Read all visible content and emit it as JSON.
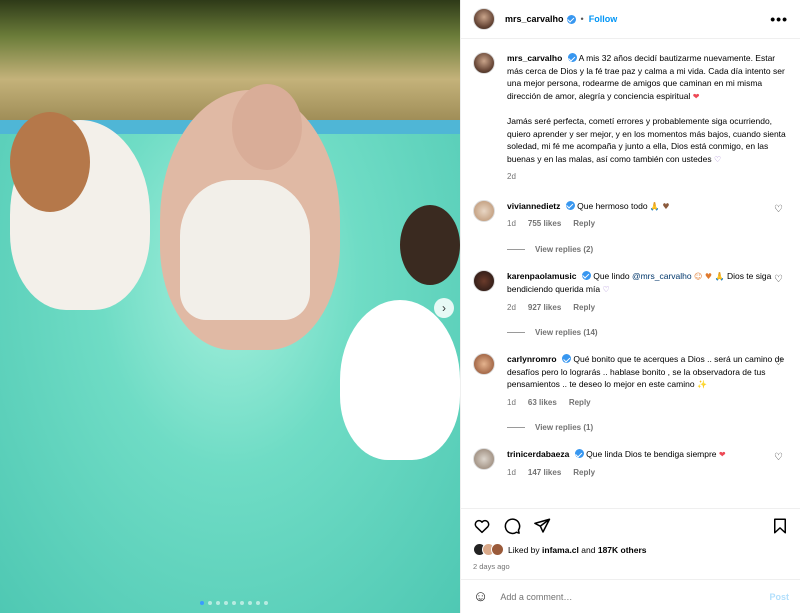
{
  "post": {
    "username": "mrs_carvalho",
    "follow_label": "Follow",
    "more_label": "•••"
  },
  "caption": {
    "username": "mrs_carvalho",
    "paragraph1": "A mis 32 años decidí bautizarme nuevamente. Estar más cerca de Dios y la fé trae paz y calma a mi vida. Cada día intento ser una mejor persona, rodearme de amigos que caminan en mi misma dirección de amor, alegría y conciencia espiritual",
    "paragraph1_emoji": "❤",
    "paragraph2": "Jamás seré perfecta, cometí errores y probablemente siga ocurriendo, quiero aprender y ser mejor, y en los momentos más bajos, cuando sienta soledad, mi fé me acompaña y junto a ella, Dios está conmigo, en las buenas y en las malas, así como también con ustedes",
    "paragraph2_emoji": "♡",
    "time": "2d"
  },
  "comments": [
    {
      "username": "viviannedietz",
      "text": "Que hermoso todo",
      "emoji": "🙏 ♥",
      "time": "1d",
      "likes": "755 likes",
      "reply_label": "Reply",
      "view_replies": "View replies (2)"
    },
    {
      "username": "karenpaolamusic",
      "text_before": "Que lindo",
      "mention": "@mrs_carvalho",
      "emoji": "☺ ♥ 🙏",
      "text_after": "Dios te siga bendiciendo querida mía",
      "emoji_after": "♡",
      "time": "2d",
      "likes": "927 likes",
      "reply_label": "Reply",
      "view_replies": "View replies (14)"
    },
    {
      "username": "carlynromro",
      "text": "Qué bonito que te acerques a Dios .. será un camino de desafíos pero lo lograrás .. hablase bonito , se la observadora de tus pensamientos .. te deseo lo mejor en este camino",
      "emoji": "✨",
      "time": "1d",
      "likes": "63 likes",
      "reply_label": "Reply",
      "view_replies": "View replies (1)"
    },
    {
      "username": "trinicerdabaeza",
      "text": "Que linda Dios te bendiga siempre",
      "emoji": "❤",
      "time": "1d",
      "likes": "147 likes",
      "reply_label": "Reply"
    }
  ],
  "likes_summary": {
    "prefix": "Liked by",
    "user": "infama.cl",
    "middle": "and",
    "others": "187K others"
  },
  "post_date": "2 days ago",
  "comment_input": {
    "placeholder": "Add a comment…",
    "post_label": "Post"
  },
  "colors": {
    "link_blue": "#0095f6",
    "verified_blue": "#3897f0",
    "meta_gray": "#737373",
    "like_red": "#ed4956"
  },
  "carousel": {
    "slide_count": 9,
    "current_slide": 1
  }
}
